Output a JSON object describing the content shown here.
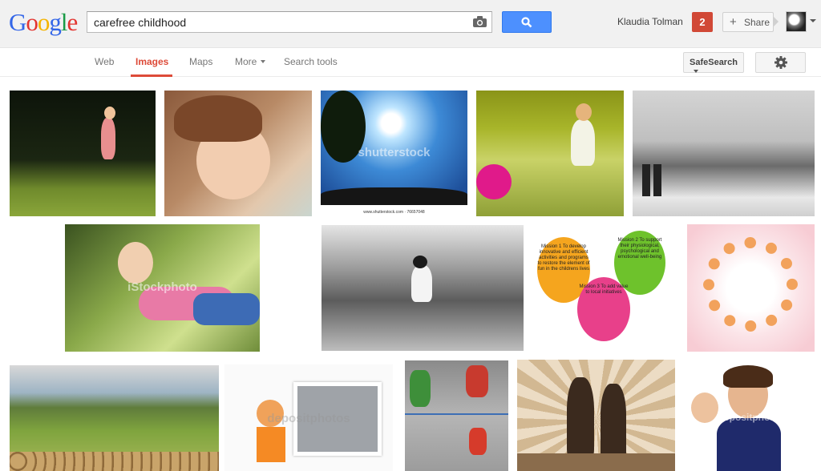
{
  "header": {
    "logo_letters": [
      "G",
      "o",
      "o",
      "g",
      "l",
      "e"
    ],
    "search_value": "carefree childhood",
    "user_name": "Klaudia Tolman",
    "notification_count": "2",
    "share_label": "Share"
  },
  "nav": {
    "tabs": [
      "Web",
      "Images",
      "Maps",
      "More",
      "Search tools"
    ],
    "active_tab": "Images",
    "safesearch_label": "SafeSearch"
  },
  "results": {
    "watermarks": [
      "shutterstock",
      "iStockphoto",
      "depositphotos",
      "depositphotos"
    ],
    "caption_shutterstock": "www.shutterstock.com · 76657048",
    "missions": [
      "Mission 1\nTo develop innovative and efficient activities and programs to restore the element of fun in the childrens lives",
      "Mission 2\nTo support their physiological, psychological and emotional well-being",
      "Mission 3\nTo add value to local initiatives"
    ]
  },
  "colors": {
    "search_blue": "#4d90fe",
    "accent_red": "#dd4b39",
    "notification_red": "#d14836"
  }
}
